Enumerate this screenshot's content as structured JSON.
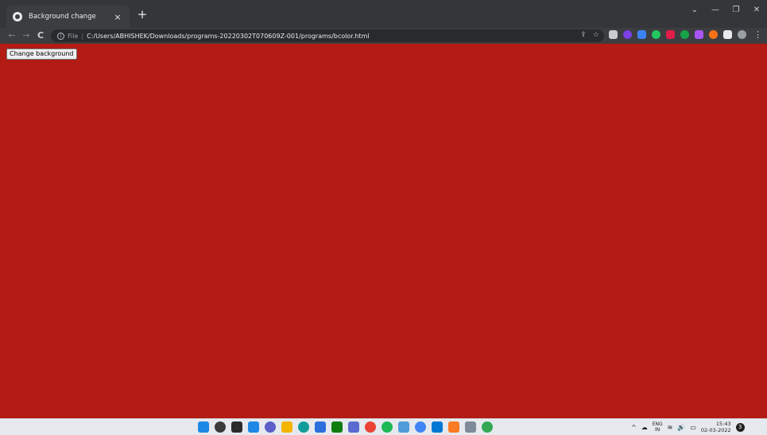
{
  "colors": {
    "page_background": "#b31b15",
    "tabstrip": "#35363a",
    "toolbar": "#3c3d41",
    "taskbar": "#e6e9ee"
  },
  "tab": {
    "title": "Background change",
    "favicon": "globe-icon",
    "close_glyph": "×"
  },
  "new_tab_glyph": "+",
  "window_controls": {
    "chevron": "⌄",
    "minimize": "—",
    "restore": "❐",
    "close": "✕"
  },
  "nav": {
    "back": "←",
    "forward": "→",
    "reload": "C"
  },
  "omnibox": {
    "info_glyph": "i",
    "scheme_label": "File",
    "separator": "|",
    "url": "C:/Users/ABHISHEK/Downloads/programs-20220302T070609Z-001/programs/bcolor.html",
    "share_glyph": "⇪",
    "star_glyph": "☆"
  },
  "extensions": [
    {
      "name": "camera-extension-icon",
      "color": "#c9ccd1"
    },
    {
      "name": "red-circle-extension-icon",
      "color": "#7b3fe4"
    },
    {
      "name": "blue-diamond-extension-icon",
      "color": "#3b82f6"
    },
    {
      "name": "green-extension-icon",
      "color": "#22c55e"
    },
    {
      "name": "pink-extension-icon",
      "color": "#e11d48"
    },
    {
      "name": "lime-extension-icon",
      "color": "#16a34a"
    },
    {
      "name": "purple-extension-icon",
      "color": "#a855f7"
    },
    {
      "name": "orange-extension-icon",
      "color": "#f97316"
    },
    {
      "name": "puzzle-extension-icon",
      "color": "#e8eaed"
    },
    {
      "name": "profile-extension-icon",
      "color": "#9aa0a6"
    }
  ],
  "menu_glyph": "⋮",
  "page": {
    "button_label": "Change background"
  },
  "taskbar": {
    "apps": [
      {
        "name": "windows-start-icon",
        "color": "#1e88e5",
        "shape": "square"
      },
      {
        "name": "search-icon",
        "color": "#3b3b3b",
        "shape": "circle"
      },
      {
        "name": "task-view-icon",
        "color": "#2b2b2b",
        "shape": "square"
      },
      {
        "name": "widgets-icon",
        "color": "#1e88e5",
        "shape": "square"
      },
      {
        "name": "chat-icon",
        "color": "#5b5fc7",
        "shape": "circle"
      },
      {
        "name": "file-explorer-icon",
        "color": "#f4b400",
        "shape": "square"
      },
      {
        "name": "edge-icon",
        "color": "#0f9d9a",
        "shape": "circle"
      },
      {
        "name": "store-icon",
        "color": "#2c6fdc",
        "shape": "square"
      },
      {
        "name": "xbox-icon",
        "color": "#107c10",
        "shape": "square"
      },
      {
        "name": "photos-icon",
        "color": "#5b6ad0",
        "shape": "square"
      },
      {
        "name": "chrome-icon",
        "color": "#ea4335",
        "shape": "circle"
      },
      {
        "name": "spotify-icon",
        "color": "#1db954",
        "shape": "circle"
      },
      {
        "name": "notepad-icon",
        "color": "#4f9bd9",
        "shape": "square"
      },
      {
        "name": "chrome-profile-icon",
        "color": "#4285f4",
        "shape": "circle"
      },
      {
        "name": "vscode-icon",
        "color": "#0078d4",
        "shape": "square"
      },
      {
        "name": "xampp-icon",
        "color": "#fb7a24",
        "shape": "square"
      },
      {
        "name": "snipping-tool-icon",
        "color": "#7e8a97",
        "shape": "square"
      },
      {
        "name": "chrome-alt-icon",
        "color": "#34a853",
        "shape": "circle"
      }
    ],
    "tray": {
      "chevron": "^",
      "cloud_glyph": "☁",
      "lang_top": "ENG",
      "lang_bottom": "IN",
      "wifi_glyph": "≋",
      "volume_glyph": "🔊",
      "battery_glyph": "▭",
      "time": "15:43",
      "date": "02-03-2022",
      "notifications": "3"
    }
  }
}
